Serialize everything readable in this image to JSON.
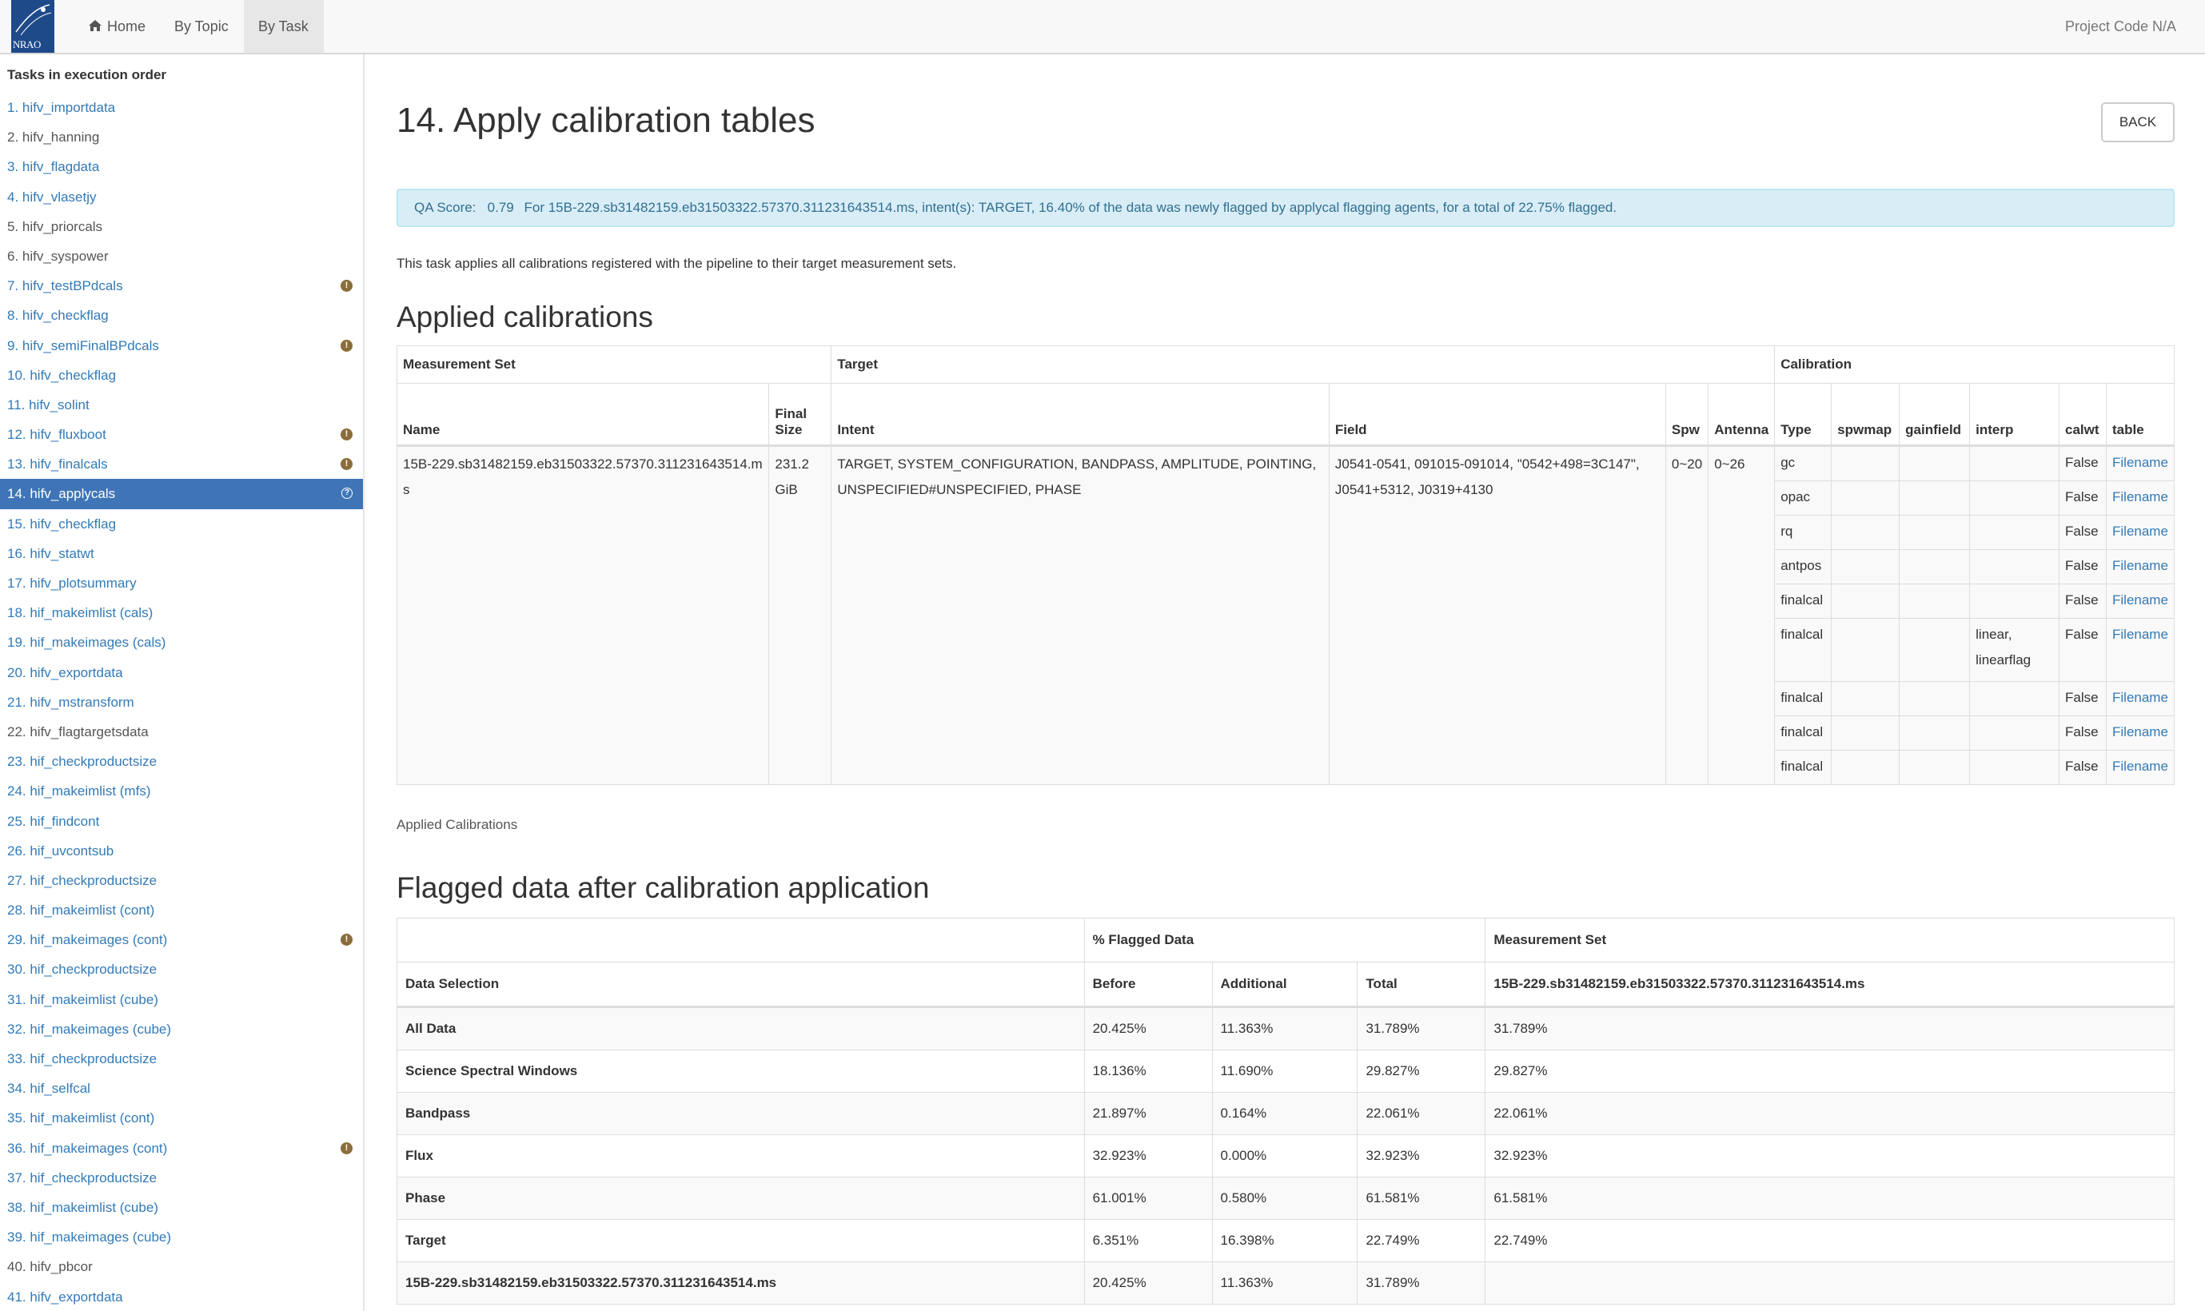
{
  "navbar": {
    "logo_text": "NRAO",
    "home_label": "Home",
    "by_topic_label": "By Topic",
    "by_task_label": "By Task",
    "project_code": "Project Code N/A"
  },
  "sidebar": {
    "title": "Tasks in execution order",
    "items": [
      {
        "label": "1. hifv_importdata",
        "style": "link",
        "badge": ""
      },
      {
        "label": "2. hifv_hanning",
        "style": "plain",
        "badge": ""
      },
      {
        "label": "3. hifv_flagdata",
        "style": "link",
        "badge": ""
      },
      {
        "label": "4. hifv_vlasetjy",
        "style": "link",
        "badge": ""
      },
      {
        "label": "5. hifv_priorcals",
        "style": "plain",
        "badge": ""
      },
      {
        "label": "6. hifv_syspower",
        "style": "plain",
        "badge": ""
      },
      {
        "label": "7. hifv_testBPdcals",
        "style": "link",
        "badge": "warning"
      },
      {
        "label": "8. hifv_checkflag",
        "style": "link",
        "badge": ""
      },
      {
        "label": "9. hifv_semiFinalBPdcals",
        "style": "link",
        "badge": "warning"
      },
      {
        "label": "10. hifv_checkflag",
        "style": "link",
        "badge": ""
      },
      {
        "label": "11. hifv_solint",
        "style": "link",
        "badge": ""
      },
      {
        "label": "12. hifv_fluxboot",
        "style": "link",
        "badge": "warning"
      },
      {
        "label": "13. hifv_finalcals",
        "style": "link",
        "badge": "warning"
      },
      {
        "label": "14. hifv_applycals",
        "style": "active",
        "badge": "question"
      },
      {
        "label": "15. hifv_checkflag",
        "style": "link",
        "badge": ""
      },
      {
        "label": "16. hifv_statwt",
        "style": "link",
        "badge": ""
      },
      {
        "label": "17. hifv_plotsummary",
        "style": "link",
        "badge": ""
      },
      {
        "label": "18. hif_makeimlist (cals)",
        "style": "link",
        "badge": ""
      },
      {
        "label": "19. hif_makeimages (cals)",
        "style": "link",
        "badge": ""
      },
      {
        "label": "20. hifv_exportdata",
        "style": "link",
        "badge": ""
      },
      {
        "label": "21. hifv_mstransform",
        "style": "link",
        "badge": ""
      },
      {
        "label": "22. hifv_flagtargetsdata",
        "style": "plain",
        "badge": ""
      },
      {
        "label": "23. hif_checkproductsize",
        "style": "link",
        "badge": ""
      },
      {
        "label": "24. hif_makeimlist (mfs)",
        "style": "link",
        "badge": ""
      },
      {
        "label": "25. hif_findcont",
        "style": "link",
        "badge": ""
      },
      {
        "label": "26. hif_uvcontsub",
        "style": "link",
        "badge": ""
      },
      {
        "label": "27. hif_checkproductsize",
        "style": "link",
        "badge": ""
      },
      {
        "label": "28. hif_makeimlist (cont)",
        "style": "link",
        "badge": ""
      },
      {
        "label": "29. hif_makeimages (cont)",
        "style": "link",
        "badge": "warning"
      },
      {
        "label": "30. hif_checkproductsize",
        "style": "link",
        "badge": ""
      },
      {
        "label": "31. hif_makeimlist (cube)",
        "style": "link",
        "badge": ""
      },
      {
        "label": "32. hif_makeimages (cube)",
        "style": "link",
        "badge": ""
      },
      {
        "label": "33. hif_checkproductsize",
        "style": "link",
        "badge": ""
      },
      {
        "label": "34. hif_selfcal",
        "style": "link",
        "badge": ""
      },
      {
        "label": "35. hif_makeimlist (cont)",
        "style": "link",
        "badge": ""
      },
      {
        "label": "36. hif_makeimages (cont)",
        "style": "link",
        "badge": "warning"
      },
      {
        "label": "37. hif_checkproductsize",
        "style": "link",
        "badge": ""
      },
      {
        "label": "38. hif_makeimlist (cube)",
        "style": "link",
        "badge": ""
      },
      {
        "label": "39. hif_makeimages (cube)",
        "style": "link",
        "badge": ""
      },
      {
        "label": "40. hifv_pbcor",
        "style": "plain",
        "badge": ""
      },
      {
        "label": "41. hifv_exportdata",
        "style": "link",
        "badge": ""
      }
    ]
  },
  "main": {
    "title": "14. Apply calibration tables",
    "back_label": "BACK",
    "qa": {
      "label": "QA Score:",
      "score": "0.79",
      "message": "For 15B-229.sb31482159.eb31503322.57370.311231643514.ms, intent(s): TARGET, 16.40% of the data was newly flagged by applycal flagging agents, for a total of 22.75% flagged."
    },
    "intro": "This task applies all calibrations registered with the pipeline to their target measurement sets.",
    "applied_heading": "Applied calibrations",
    "applied_caption": "Applied Calibrations",
    "flagged_heading": "Flagged data after calibration application"
  },
  "cal_table": {
    "group_headers": {
      "ms": "Measurement Set",
      "target": "Target",
      "calibration": "Calibration"
    },
    "headers": {
      "name": "Name",
      "final_size": "Final Size",
      "intent": "Intent",
      "field": "Field",
      "spw": "Spw",
      "antenna": "Antenna",
      "type": "Type",
      "spwmap": "spwmap",
      "gainfield": "gainfield",
      "interp": "interp",
      "calwt": "calwt",
      "table": "table"
    },
    "ms_name": "15B-229.sb31482159.eb31503322.57370.311231643514.ms",
    "final_size": "231.2 GiB",
    "intent": "TARGET, SYSTEM_CONFIGURATION, BANDPASS, AMPLITUDE, POINTING, UNSPECIFIED#UNSPECIFIED, PHASE",
    "field": "J0541-0541, 091015-091014, \"0542+498=3C147\", J0541+5312, J0319+4130",
    "spw": "0~20",
    "antenna": "0~26",
    "rows": [
      {
        "type": "gc",
        "spwmap": "",
        "gainfield": "",
        "interp": "",
        "calwt": "False",
        "table": "Filename"
      },
      {
        "type": "opac",
        "spwmap": "",
        "gainfield": "",
        "interp": "",
        "calwt": "False",
        "table": "Filename"
      },
      {
        "type": "rq",
        "spwmap": "",
        "gainfield": "",
        "interp": "",
        "calwt": "False",
        "table": "Filename"
      },
      {
        "type": "antpos",
        "spwmap": "",
        "gainfield": "",
        "interp": "",
        "calwt": "False",
        "table": "Filename"
      },
      {
        "type": "finalcal",
        "spwmap": "",
        "gainfield": "",
        "interp": "",
        "calwt": "False",
        "table": "Filename"
      },
      {
        "type": "finalcal",
        "spwmap": "",
        "gainfield": "",
        "interp": "linear, linearflag",
        "calwt": "False",
        "table": "Filename"
      },
      {
        "type": "finalcal",
        "spwmap": "",
        "gainfield": "",
        "interp": "",
        "calwt": "False",
        "table": "Filename"
      },
      {
        "type": "finalcal",
        "spwmap": "",
        "gainfield": "",
        "interp": "",
        "calwt": "False",
        "table": "Filename"
      },
      {
        "type": "finalcal",
        "spwmap": "",
        "gainfield": "",
        "interp": "",
        "calwt": "False",
        "table": "Filename"
      }
    ]
  },
  "flag_table": {
    "group_headers": {
      "pct": "% Flagged Data",
      "ms": "Measurement Set"
    },
    "headers": {
      "selection": "Data Selection",
      "before": "Before",
      "additional": "Additional",
      "total": "Total",
      "ms_name": "15B-229.sb31482159.eb31503322.57370.311231643514.ms"
    },
    "rows": [
      {
        "label": "All Data",
        "before": "20.425%",
        "additional": "11.363%",
        "total": "31.789%",
        "ms": "31.789%"
      },
      {
        "label": "Science Spectral Windows",
        "before": "18.136%",
        "additional": "11.690%",
        "total": "29.827%",
        "ms": "29.827%"
      },
      {
        "label": "Bandpass",
        "before": "21.897%",
        "additional": "0.164%",
        "total": "22.061%",
        "ms": "22.061%"
      },
      {
        "label": "Flux",
        "before": "32.923%",
        "additional": "0.000%",
        "total": "32.923%",
        "ms": "32.923%"
      },
      {
        "label": "Phase",
        "before": "61.001%",
        "additional": "0.580%",
        "total": "61.581%",
        "ms": "61.581%"
      },
      {
        "label": "Target",
        "before": "6.351%",
        "additional": "16.398%",
        "total": "22.749%",
        "ms": "22.749%"
      },
      {
        "label": "15B-229.sb31482159.eb31503322.57370.311231643514.ms",
        "before": "20.425%",
        "additional": "11.363%",
        "total": "31.789%",
        "ms": ""
      }
    ]
  },
  "colors": {
    "link": "#337ab7",
    "active_bg": "#3f75b7",
    "qa_bg": "#d9edf7",
    "qa_text": "#31708f",
    "warning_badge": "#8a6d3b"
  }
}
